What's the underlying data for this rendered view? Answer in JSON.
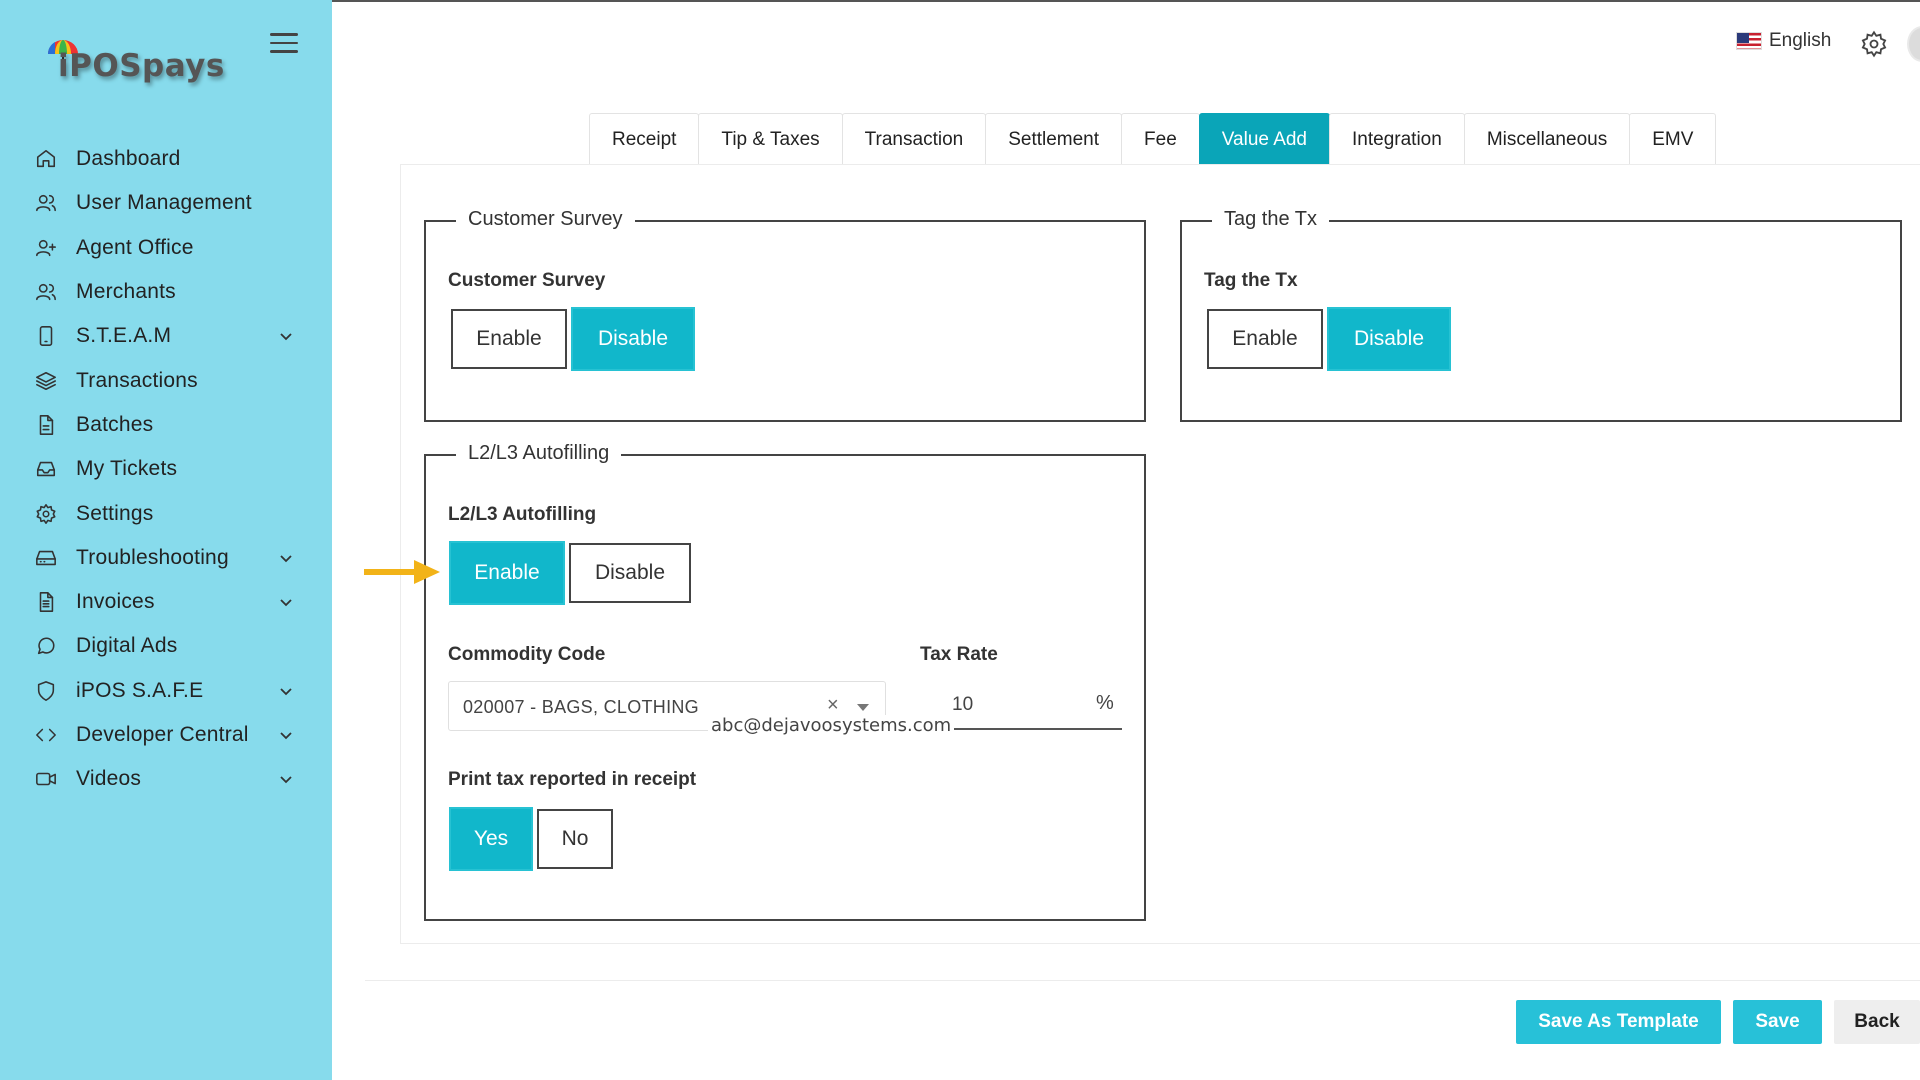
{
  "app": {
    "logo_text": "iPOSpays",
    "language": "English"
  },
  "sidebar": {
    "items": [
      {
        "label": "Dashboard",
        "icon": "home-icon",
        "has_submenu": false
      },
      {
        "label": "User Management",
        "icon": "users-icon",
        "has_submenu": false
      },
      {
        "label": "Agent Office",
        "icon": "user-plus-icon",
        "has_submenu": false
      },
      {
        "label": "Merchants",
        "icon": "users-icon",
        "has_submenu": false
      },
      {
        "label": "S.T.E.A.M",
        "icon": "tablet-icon",
        "has_submenu": true
      },
      {
        "label": "Transactions",
        "icon": "layers-icon",
        "has_submenu": false
      },
      {
        "label": "Batches",
        "icon": "file-icon",
        "has_submenu": false
      },
      {
        "label": "My Tickets",
        "icon": "inbox-icon",
        "has_submenu": false
      },
      {
        "label": "Settings",
        "icon": "gear-icon",
        "has_submenu": false
      },
      {
        "label": "Troubleshooting",
        "icon": "hard-drive-icon",
        "has_submenu": true
      },
      {
        "label": "Invoices",
        "icon": "file-text-icon",
        "has_submenu": true
      },
      {
        "label": "Digital Ads",
        "icon": "message-circle-icon",
        "has_submenu": false
      },
      {
        "label": "iPOS S.A.F.E",
        "icon": "shield-icon",
        "has_submenu": true
      },
      {
        "label": "Developer Central",
        "icon": "code-icon",
        "has_submenu": true
      },
      {
        "label": "Videos",
        "icon": "video-icon",
        "has_submenu": true
      }
    ]
  },
  "tabs": [
    {
      "label": "Receipt",
      "active": false
    },
    {
      "label": "Tip & Taxes",
      "active": false
    },
    {
      "label": "Transaction",
      "active": false
    },
    {
      "label": "Settlement",
      "active": false
    },
    {
      "label": "Fee",
      "active": false
    },
    {
      "label": "Value Add",
      "active": true
    },
    {
      "label": "Integration",
      "active": false
    },
    {
      "label": "Miscellaneous",
      "active": false
    },
    {
      "label": "EMV",
      "active": false
    }
  ],
  "customer_survey": {
    "legend": "Customer Survey",
    "label": "Customer Survey",
    "enable_label": "Enable",
    "disable_label": "Disable",
    "selected": "Disable"
  },
  "tag_the_tx": {
    "legend": "Tag the Tx",
    "label": "Tag the Tx",
    "enable_label": "Enable",
    "disable_label": "Disable",
    "selected": "Disable"
  },
  "l2l3": {
    "legend": "L2/L3 Autofilling",
    "label": "L2/L3 Autofilling",
    "enable_label": "Enable",
    "disable_label": "Disable",
    "selected": "Enable",
    "commodity_code_label": "Commodity Code",
    "commodity_code_value": "020007 - BAGS, CLOTHING",
    "clear_symbol": "×",
    "tax_rate_label": "Tax Rate",
    "tax_rate_value": "10",
    "tax_rate_unit": "%",
    "print_tax_label": "Print tax reported in receipt",
    "yes_label": "Yes",
    "no_label": "No",
    "print_tax_selected": "Yes"
  },
  "overlay_email": "abc@dejavoosystems.com",
  "footer": {
    "save_template_label": "Save As Template",
    "save_label": "Save",
    "back_label": "Back"
  },
  "colors": {
    "sidebar_bg": "#87dbec",
    "accent": "#11b7cb",
    "tab_active": "#0aa5b8",
    "arrow": "#f2b318"
  }
}
